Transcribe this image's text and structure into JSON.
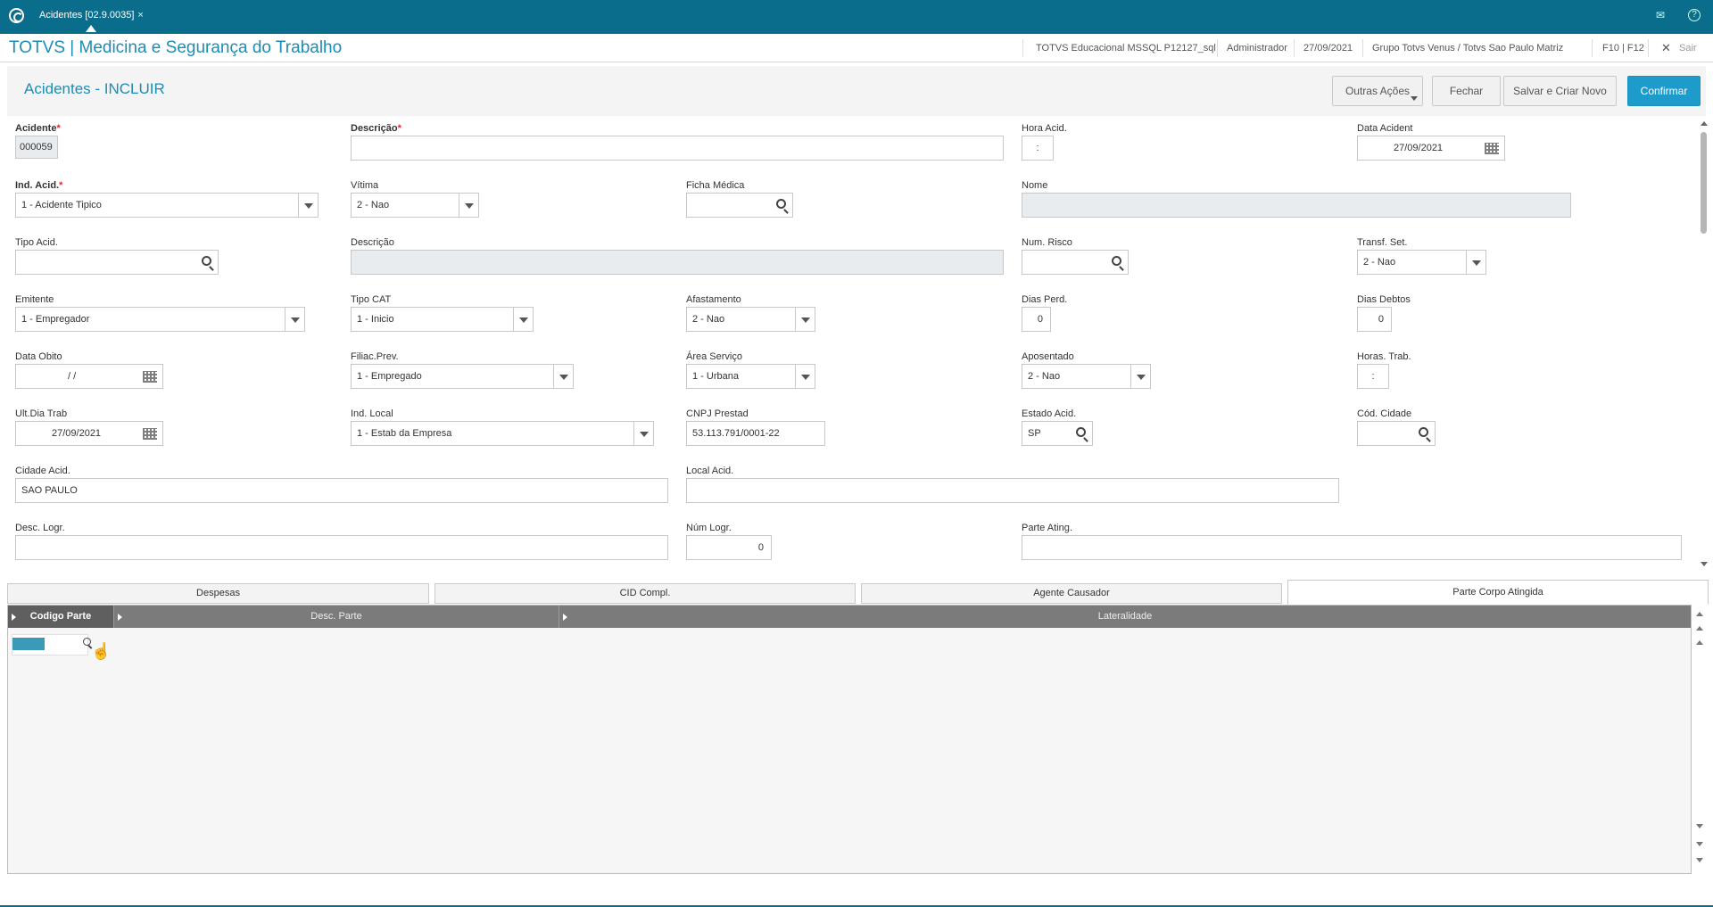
{
  "topbar": {
    "tab_label": "Acidentes [02.9.0035]",
    "tab_close": "×",
    "mail_icon": "✉",
    "help_icon": "?"
  },
  "header": {
    "app_title": "TOTVS | Medicina e Segurança do Trabalho",
    "environment": "TOTVS Educacional MSSQL P12127_sql",
    "user": "Administrador",
    "date": "27/09/2021",
    "company": "Grupo Totvs Venus / Totvs Sao Paulo Matriz",
    "shortcut": "F10 | F12",
    "exit_icon": "✕",
    "exit": "Sair"
  },
  "page": {
    "title": "Acidentes - INCLUIR",
    "actions": {
      "more": "Outras Ações",
      "close": "Fechar",
      "save_new": "Salvar e Criar Novo",
      "confirm": "Confirmar"
    }
  },
  "form": {
    "acidente": {
      "label": "Acidente",
      "value": "000059"
    },
    "descricao": {
      "label": "Descrição",
      "value": ""
    },
    "hora_acid": {
      "label": "Hora Acid.",
      "value": ":"
    },
    "data_acident": {
      "label": "Data Acident",
      "value": "27/09/2021"
    },
    "ind_acid": {
      "label": "Ind. Acid.",
      "value": "1 - Acidente Tipico"
    },
    "vitima": {
      "label": "Vítima",
      "value": "2 - Nao"
    },
    "ficha_medica": {
      "label": "Ficha Médica",
      "value": ""
    },
    "nome": {
      "label": "Nome",
      "value": ""
    },
    "tipo_acid": {
      "label": "Tipo Acid.",
      "value": ""
    },
    "descricao2": {
      "label": "Descrição",
      "value": ""
    },
    "num_risco": {
      "label": "Num. Risco",
      "value": ""
    },
    "transf_set": {
      "label": "Transf. Set.",
      "value": "2 - Nao"
    },
    "emitente": {
      "label": "Emitente",
      "value": "1 - Empregador"
    },
    "tipo_cat": {
      "label": "Tipo CAT",
      "value": "1 - Inicio"
    },
    "afastamento": {
      "label": "Afastamento",
      "value": "2 - Nao"
    },
    "dias_perd": {
      "label": "Dias Perd.",
      "value": "0"
    },
    "dias_debtos": {
      "label": "Dias Debtos",
      "value": "0"
    },
    "data_obito": {
      "label": "Data Obito",
      "value": "/ /"
    },
    "filiac_prev": {
      "label": "Filiac.Prev.",
      "value": "1 - Empregado"
    },
    "area_servico": {
      "label": "Área Serviço",
      "value": "1 - Urbana"
    },
    "aposentado": {
      "label": "Aposentado",
      "value": "2 - Nao"
    },
    "horas_trab": {
      "label": "Horas. Trab.",
      "value": ":"
    },
    "ult_dia_trab": {
      "label": "Ult.Dia Trab",
      "value": "27/09/2021"
    },
    "ind_local": {
      "label": "Ind. Local",
      "value": "1 - Estab da Empresa"
    },
    "cnpj_prestad": {
      "label": "CNPJ Prestad",
      "value": "53.113.791/0001-22"
    },
    "estado_acid": {
      "label": "Estado Acid.",
      "value": "SP"
    },
    "cod_cidade": {
      "label": "Cód. Cidade",
      "value": ""
    },
    "cidade_acid": {
      "label": "Cidade Acid.",
      "value": "SAO PAULO"
    },
    "local_acid": {
      "label": "Local Acid.",
      "value": ""
    },
    "desc_logr": {
      "label": "Desc. Logr.",
      "value": ""
    },
    "num_logr": {
      "label": "Núm Logr.",
      "value": "0"
    },
    "parte_ating": {
      "label": "Parte Ating.",
      "value": ""
    },
    "required_mark": "*"
  },
  "tabs": [
    "Despesas",
    "CID Compl.",
    "Agente Causador",
    "Parte Corpo Atingida"
  ],
  "grid": {
    "columns": [
      "Codigo Parte",
      "Desc. Parte",
      "Lateralidade"
    ]
  }
}
